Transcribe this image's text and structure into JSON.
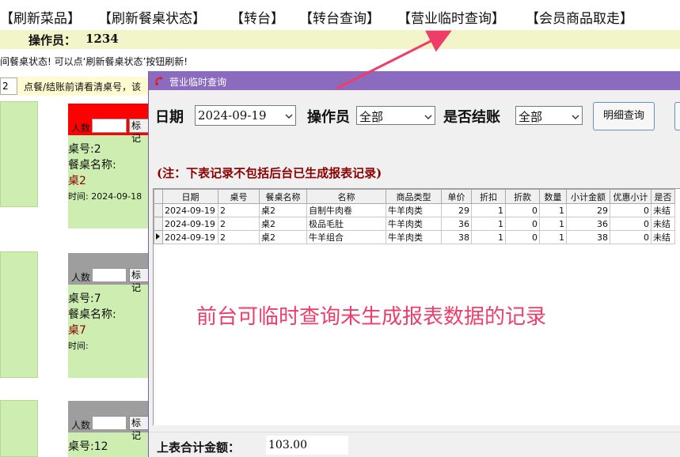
{
  "menu": {
    "items": [
      "【刷新菜品】",
      "【刷新餐桌状态】",
      "【转台】",
      "【转台查询】",
      "【营业临时查询】",
      "【会员商品取走】"
    ]
  },
  "operator": {
    "label": "操作员：",
    "value": "1234"
  },
  "notices": {
    "line1": "间餐桌状态! 可以点‘刷新餐桌状态’按钮刷新!",
    "line2_input": "2",
    "line2_text": "点餐/结账前请看清桌号，该"
  },
  "cards": [
    {
      "people_label": "人数",
      "mark_label": "标记",
      "table_no": "桌号:2",
      "name_label": "餐桌名称:",
      "name": "桌2",
      "time": "时间: 2024-09-18",
      "head_color": "#ff0000"
    },
    {
      "people_label": "人数",
      "mark_label": "标记",
      "table_no": "桌号:7",
      "name_label": "餐桌名称:",
      "name": "桌7",
      "time": "时间:",
      "head_color": "#9e9e9e"
    },
    {
      "people_label": "人数",
      "mark_label": "标记",
      "table_no": "桌号:12",
      "head_color": "#9e9e9e"
    }
  ],
  "dialog": {
    "title": "营业临时查询",
    "date_label": "日期",
    "date_value": "2024-09-19",
    "operator_label": "操作员",
    "operator_value": "全部",
    "settled_label": "是否结账",
    "settled_value": "全部",
    "detail_button": "明细查询",
    "note": "(注：下表记录不包括后台已生成报表记录)",
    "annotation": "前台可临时查询未生成报表数据的记录",
    "footer_label": "上表合计金额：",
    "footer_value": "103.00",
    "accent_color": "#8b6bbf"
  },
  "grid": {
    "columns": [
      "日期",
      "桌号",
      "餐桌名称",
      "名称",
      "商品类型",
      "单价",
      "折扣",
      "折款",
      "数量",
      "小计金额",
      "优惠小计",
      "是否"
    ],
    "rows": [
      [
        "2024-09-19",
        "2",
        "桌2",
        "自制牛肉卷",
        "牛羊肉类",
        "29",
        "1",
        "0",
        "1",
        "29",
        "0",
        "未结"
      ],
      [
        "2024-09-19",
        "2",
        "桌2",
        "极品毛肚",
        "牛羊肉类",
        "36",
        "1",
        "0",
        "1",
        "36",
        "0",
        "未结"
      ],
      [
        "2024-09-19",
        "2",
        "桌2",
        "牛羊组合",
        "牛羊肉类",
        "38",
        "1",
        "0",
        "1",
        "38",
        "0",
        "未结"
      ]
    ]
  }
}
